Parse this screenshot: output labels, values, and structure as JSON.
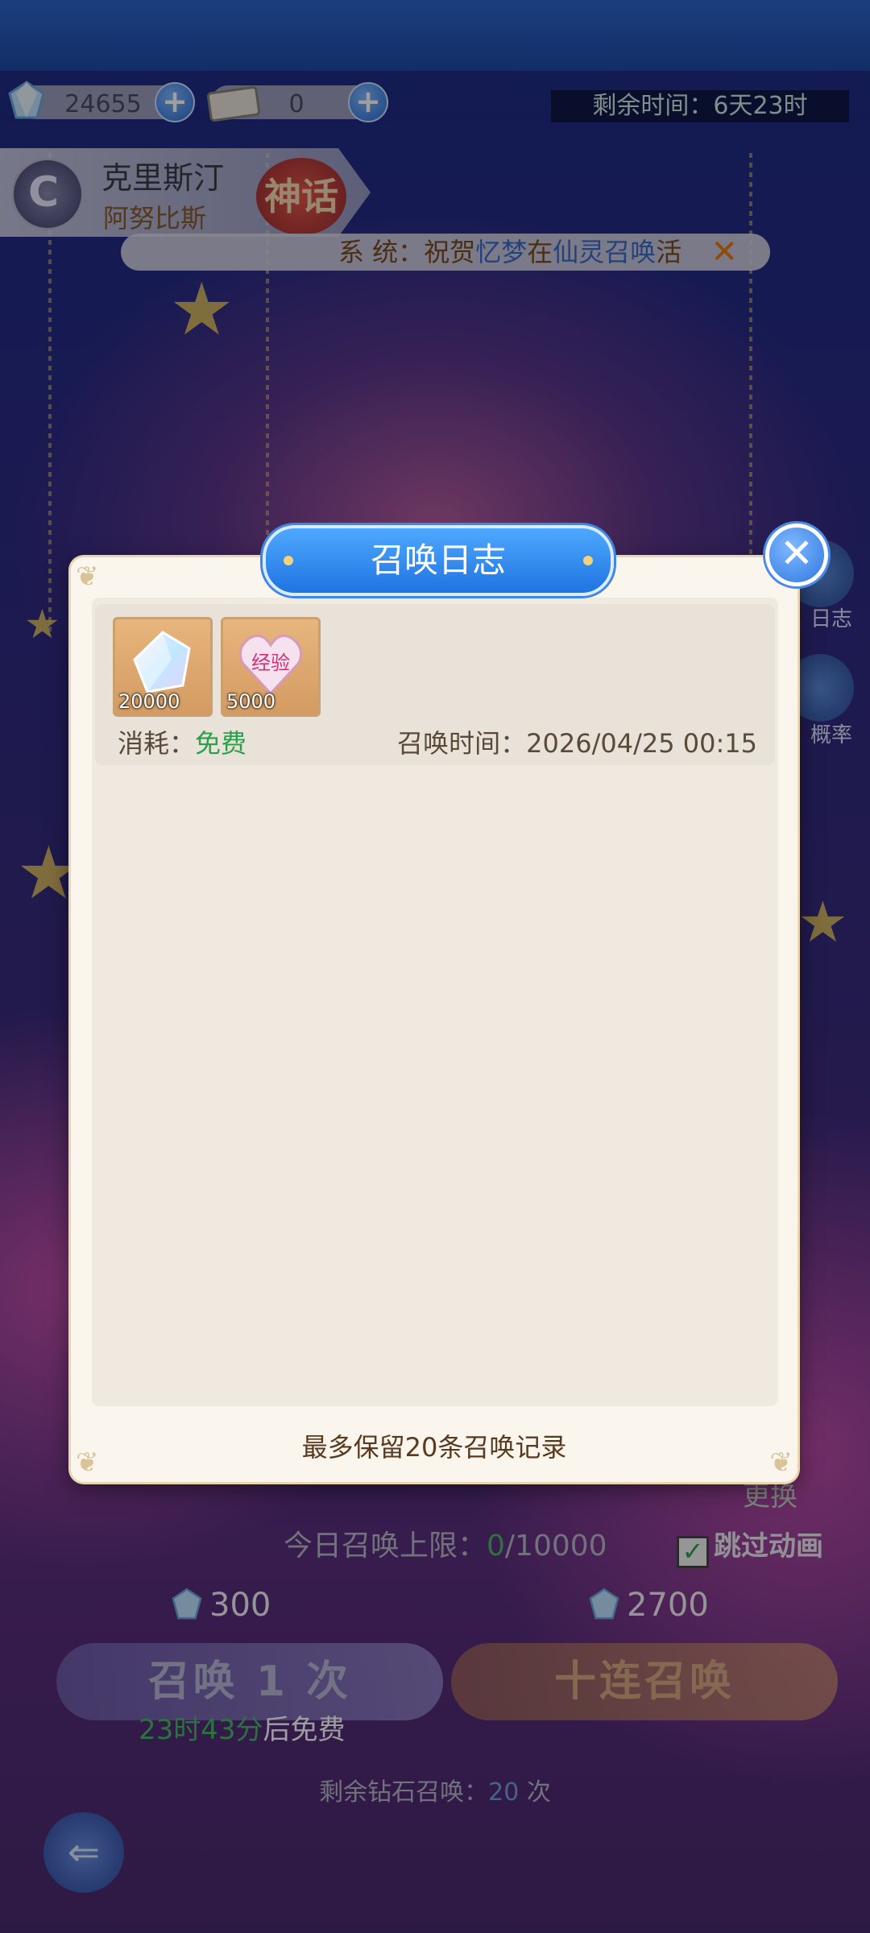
{
  "currency": {
    "diamond_amount": "24655",
    "ticket_amount": "0"
  },
  "event_timer": "剩余时间：6天23时",
  "character": {
    "name": "克里斯汀",
    "subtitle": "阿努比斯",
    "rarity_badge": "神话"
  },
  "system_message": {
    "prefix": "系  统：祝贺",
    "player": "忆梦",
    "middle": "在",
    "pool": "仙灵召唤",
    "suffix": "活"
  },
  "side_buttons": {
    "log_label": "日志",
    "rate_label": "概率"
  },
  "dialog": {
    "title": "召唤日志",
    "records": [
      {
        "items": [
          {
            "icon": "crystal-icon",
            "qty": "20000"
          },
          {
            "icon": "exp-heart-icon",
            "qty": "5000",
            "label": "经验"
          }
        ],
        "consume_label": "消耗：",
        "consume_value": "免费",
        "time_label": "召唤时间：",
        "time_value": "2026/04/25 00:15"
      }
    ],
    "footer_note": "最多保留20条召唤记录"
  },
  "summon": {
    "change_label": "更换",
    "daily_limit_label": "今日召唤上限：",
    "daily_limit_used": "0",
    "daily_limit_total": "/10000",
    "skip_animation_label": "跳过动画",
    "single_cost": "300",
    "ten_cost": "2700",
    "single_button": "召唤 1 次",
    "ten_button": "十连召唤",
    "free_timer": "23时43分",
    "free_suffix": "后免费",
    "remaining_label": "剩余钻石召唤：",
    "remaining_count": "20",
    "remaining_unit": "次"
  },
  "colors": {
    "accent_blue": "#2f78e0",
    "free_green": "#2aa04a",
    "dialog_bg": "#faf6ee"
  }
}
